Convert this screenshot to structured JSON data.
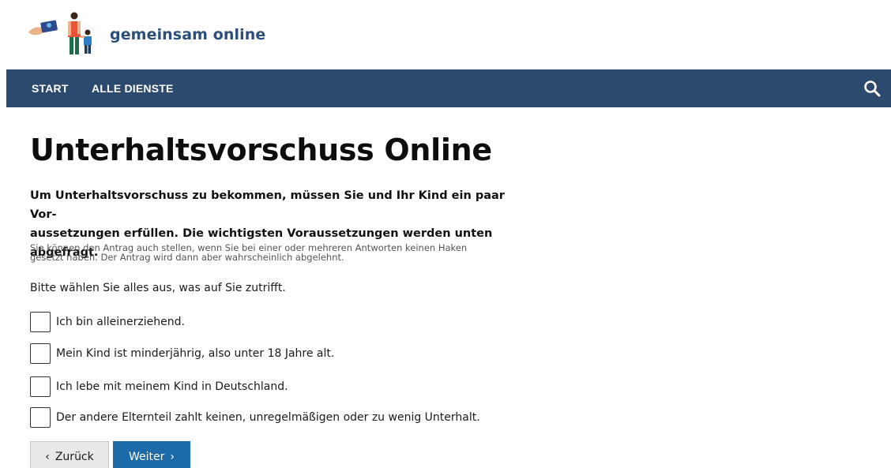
{
  "header": {
    "brand": "gemeinsam online"
  },
  "nav": {
    "items": [
      {
        "label": "START"
      },
      {
        "label": "ALLE DIENSTE"
      }
    ],
    "search_icon": "search-icon"
  },
  "main": {
    "title": "Unterhaltsvorschuss Online",
    "intro_line1": "Um Unterhaltsvorschuss zu bekommen, müssen Sie und Ihr Kind ein paar Vor-",
    "intro_line2": "aussetzungen erfüllen. Die wichtigsten Voraussetzungen werden unten",
    "intro_line3": "abgefragt.",
    "note_line1": "Sie können den Antrag auch stellen, wenn Sie bei einer oder mehreren Antworten keinen Haken",
    "note_line2": "gesetzt haben. Der Antrag wird dann aber wahrscheinlich abgelehnt.",
    "prompt": "Bitte wählen Sie alles aus, was auf Sie zutrifft.",
    "options": [
      {
        "label": "Ich bin alleinerziehend.",
        "checked": false
      },
      {
        "label": "Mein Kind ist minderjährig, also unter 18 Jahre alt.",
        "checked": false
      },
      {
        "label": "Ich lebe mit meinem Kind in Deutschland.",
        "checked": false
      },
      {
        "label": "Der andere Elternteil zahlt keinen, unregelmäßigen oder zu wenig Unterhalt.",
        "checked": false
      }
    ],
    "back_label": "Zurück",
    "next_label": "Weiter",
    "back_chevron": "‹",
    "next_chevron": "›"
  },
  "colors": {
    "nav_bg": "#2c4a6e",
    "brand": "#2b4e7a",
    "primary_button": "#1d6aa8",
    "secondary_button": "#e8e8e8"
  }
}
